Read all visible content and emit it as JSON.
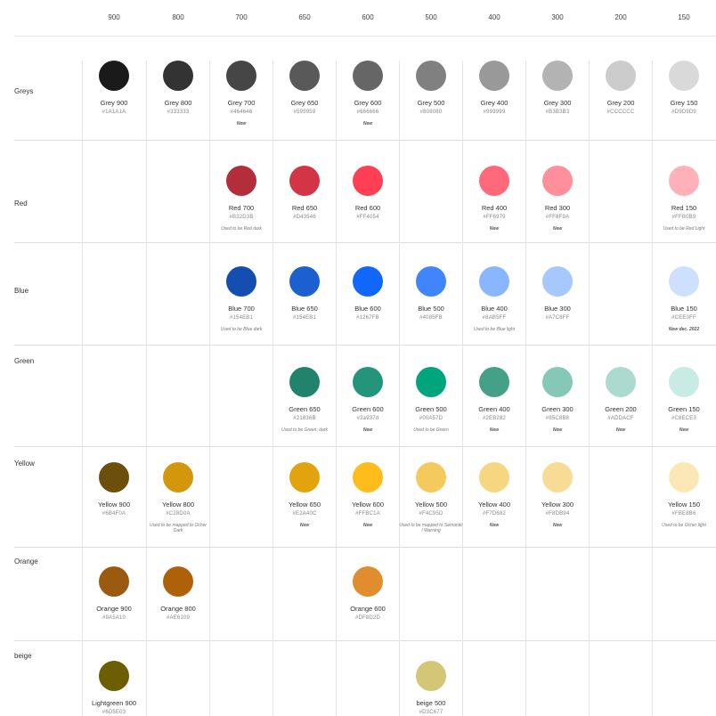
{
  "columns": [
    "900",
    "800",
    "700",
    "650",
    "600",
    "500",
    "400",
    "300",
    "200",
    "150"
  ],
  "rows": [
    {
      "label": "Greys",
      "swatches": [
        {
          "col": "900",
          "name": "Grey 900",
          "hex": "#1A1A1A",
          "color": "#1A1A1A",
          "note": ""
        },
        {
          "col": "800",
          "name": "Grey 800",
          "hex": "#333333",
          "color": "#333333",
          "note": ""
        },
        {
          "col": "700",
          "name": "Grey 700",
          "hex": "#464646",
          "color": "#464646",
          "note": "New"
        },
        {
          "col": "650",
          "name": "Grey 650",
          "hex": "#595959",
          "color": "#595959",
          "note": ""
        },
        {
          "col": "600",
          "name": "Grey 600",
          "hex": "#666666",
          "color": "#666666",
          "note": "New"
        },
        {
          "col": "500",
          "name": "Grey 500",
          "hex": "#808080",
          "color": "#808080",
          "note": ""
        },
        {
          "col": "400",
          "name": "Grey 400",
          "hex": "#999999",
          "color": "#999999",
          "note": ""
        },
        {
          "col": "300",
          "name": "Grey 300",
          "hex": "#B3B3B3",
          "color": "#B3B3B3",
          "note": ""
        },
        {
          "col": "200",
          "name": "Grey 200",
          "hex": "#CCCCCC",
          "color": "#CCCCCC",
          "note": ""
        },
        {
          "col": "150",
          "name": "Grey 150",
          "hex": "#D9D9D9",
          "color": "#D9D9D9",
          "note": ""
        }
      ]
    },
    {
      "label": "Red",
      "swatches": [
        {
          "col": "700",
          "name": "Red 700",
          "hex": "#B32D3B",
          "color": "#B32D3B",
          "note": "Used to be Red dark"
        },
        {
          "col": "650",
          "name": "Red 650",
          "hex": "#D43546",
          "color": "#D43546",
          "note": ""
        },
        {
          "col": "600",
          "name": "Red 600",
          "hex": "#FF4054",
          "color": "#FF4054",
          "note": ""
        },
        {
          "col": "400",
          "name": "Red 400",
          "hex": "#FF6979",
          "color": "#FF6979",
          "note": "New"
        },
        {
          "col": "300",
          "name": "Red 300",
          "hex": "#FF8F9A",
          "color": "#FF8F9A",
          "note": "New"
        },
        {
          "col": "150",
          "name": "Red 150",
          "hex": "#FFB0B9",
          "color": "#FFB0B9",
          "note": "Used to be Red Light"
        }
      ]
    },
    {
      "label": "Blue",
      "swatches": [
        {
          "col": "700",
          "name": "Blue 700",
          "hex": "#154EB1",
          "color": "#154EB1",
          "note": "Used to be Blue dark"
        },
        {
          "col": "650",
          "name": "Blue 650",
          "hex": "#154EB1",
          "color": "#1C5FD0",
          "note": ""
        },
        {
          "col": "600",
          "name": "Blue 600",
          "hex": "#1267FB",
          "color": "#1267FB",
          "note": ""
        },
        {
          "col": "500",
          "name": "Blue 500",
          "hex": "#4085FB",
          "color": "#4085FB",
          "note": ""
        },
        {
          "col": "400",
          "name": "Blue 400",
          "hex": "#8AB5FF",
          "color": "#8AB5FF",
          "note": "Used to be Blue light"
        },
        {
          "col": "300",
          "name": "Blue 300",
          "hex": "#A7C8FF",
          "color": "#A7C8FF",
          "note": ""
        },
        {
          "col": "150",
          "name": "Blue 150",
          "hex": "#CEE0FF",
          "color": "#CEE0FF",
          "note": "New dec. 2022"
        }
      ]
    },
    {
      "label": "Green",
      "swatches": [
        {
          "col": "650",
          "name": "Green 650",
          "hex": "#21836B",
          "color": "#21836B",
          "note": "Used to be Green: dark"
        },
        {
          "col": "600",
          "name": "Green 600",
          "hex": "#3a937d",
          "color": "#23957A",
          "note": "New"
        },
        {
          "col": "500",
          "name": "Green 500",
          "hex": "#00A57D",
          "color": "#00A57D",
          "note": "Used to be Green"
        },
        {
          "col": "400",
          "name": "Green 400",
          "hex": "#2EB282",
          "color": "#45A088",
          "note": "New"
        },
        {
          "col": "300",
          "name": "Green 300",
          "hex": "#85C8B8",
          "color": "#85C8B8",
          "note": "New"
        },
        {
          "col": "200",
          "name": "Green 200",
          "hex": "#ADDACF",
          "color": "#ADDACF",
          "note": "New"
        },
        {
          "col": "150",
          "name": "Green 150",
          "hex": "#C8ECE3",
          "color": "#C8ECE3",
          "note": "New"
        }
      ]
    },
    {
      "label": "Yellow",
      "swatches": [
        {
          "col": "900",
          "name": "Yellow 900",
          "hex": "#6B4F0A",
          "color": "#6B4F0A",
          "note": ""
        },
        {
          "col": "800",
          "name": "Yellow 800",
          "hex": "#C28D0A",
          "color": "#D4960A",
          "note": "Used to be mapped to Ocher Dark"
        },
        {
          "col": "650",
          "name": "Yellow 650",
          "hex": "#E2A40C",
          "color": "#E2A40C",
          "note": "New"
        },
        {
          "col": "600",
          "name": "Yellow 600",
          "hex": "#FFBC1A",
          "color": "#FFBC1A",
          "note": "New"
        },
        {
          "col": "500",
          "name": "Yellow 500",
          "hex": "#F4C95D",
          "color": "#F4C95D",
          "note": "Used to be mapped to Semantic / Warning"
        },
        {
          "col": "400",
          "name": "Yellow 400",
          "hex": "#F7D682",
          "color": "#F7D682",
          "note": "New"
        },
        {
          "col": "300",
          "name": "Yellow 300",
          "hex": "#F8DB94",
          "color": "#F8DB94",
          "note": "New"
        },
        {
          "col": "150",
          "name": "Yellow 150",
          "hex": "#FBE8B6",
          "color": "#FBE8B6",
          "note": "Used to be Ocher light"
        }
      ]
    },
    {
      "label": "Orange",
      "swatches": [
        {
          "col": "900",
          "name": "Orange 900",
          "hex": "#9A5A10",
          "color": "#9A5A10",
          "note": ""
        },
        {
          "col": "800",
          "name": "Orange 800",
          "hex": "#AE6109",
          "color": "#AE6109",
          "note": ""
        },
        {
          "col": "600",
          "name": "Orange 600",
          "hex": "#DF8D2D",
          "color": "#DF8D2D",
          "note": ""
        }
      ]
    },
    {
      "label": "beige",
      "swatches": [
        {
          "col": "900",
          "name": "Lightgreen 900",
          "hex": "#6D5E03",
          "color": "#6D5E03",
          "note": ""
        },
        {
          "col": "500",
          "name": "beige 500",
          "hex": "#D3C677",
          "color": "#D3C677",
          "note": ""
        }
      ]
    }
  ]
}
